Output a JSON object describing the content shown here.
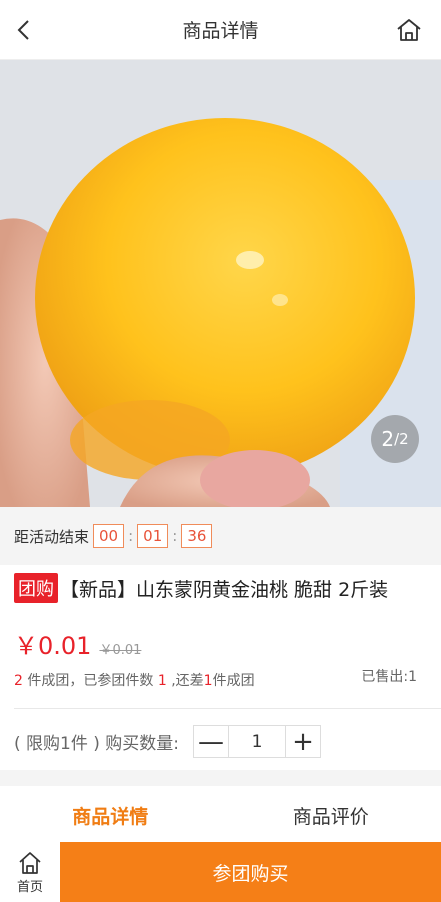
{
  "header": {
    "title": "商品详情"
  },
  "gallery": {
    "current": "2",
    "total": "/2"
  },
  "countdown": {
    "label": "距活动结束",
    "hours": "00",
    "minutes": "01",
    "seconds": "36"
  },
  "product": {
    "tag": "团购",
    "name": "【新品】山东蒙阴黄金油桃 脆甜 2斤装",
    "price": "￥0.01",
    "original_price": "￥0.01",
    "group": {
      "need": "2",
      "need_text": " 件成团，已参团件数 ",
      "joined": "1",
      "joined_text": " ,还差",
      "remain": "1",
      "remain_text": "件成团"
    },
    "sold": "已售出:1"
  },
  "quantity": {
    "label": "( 限购1件 ) 购买数量:",
    "value": "1",
    "minus": "—",
    "plus": "+"
  },
  "tabs": [
    {
      "label": "商品详情"
    },
    {
      "label": "商品评价"
    }
  ],
  "bottom": {
    "home_label": "首页",
    "buy_label": "参团购买"
  },
  "colors": {
    "accent": "#f57f17",
    "price": "#e8222a"
  }
}
